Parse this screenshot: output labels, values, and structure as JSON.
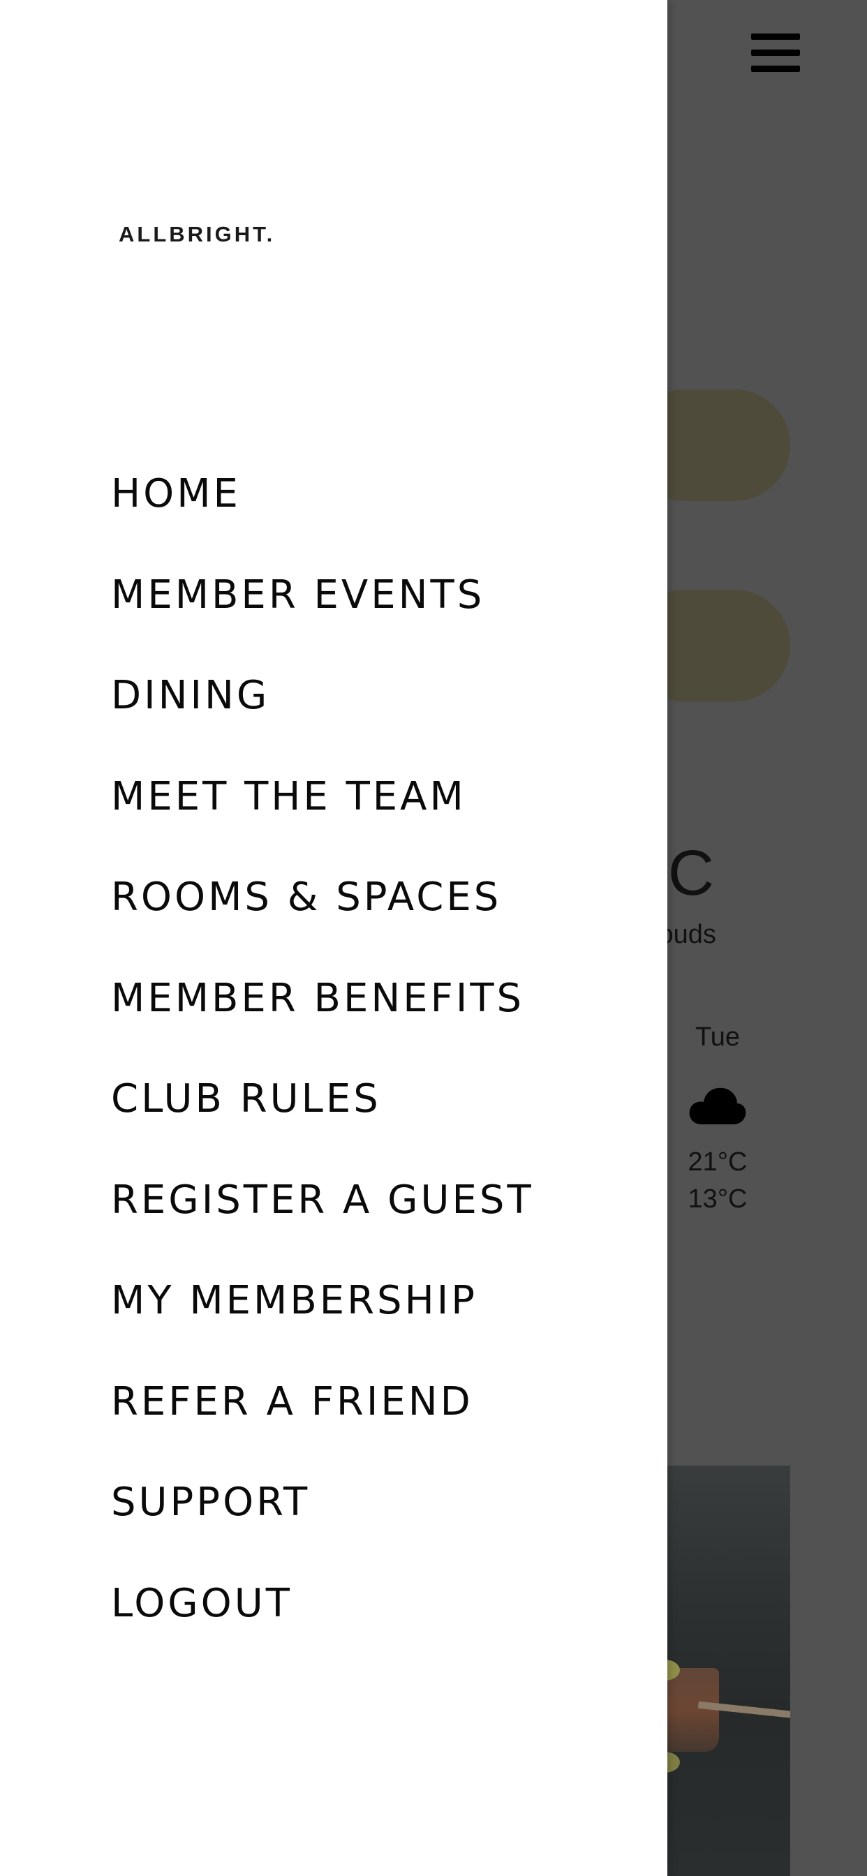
{
  "background": {
    "weather": {
      "current_temp_partial": "°C",
      "description_partial": "louds",
      "forecast": [
        {
          "day": "Tue",
          "icon": "cloud-icon",
          "high": "21°C",
          "low": "13°C"
        }
      ]
    }
  },
  "drawer": {
    "logo_text": "ALLBRIGHT.",
    "menu_items": [
      {
        "label": "HOME"
      },
      {
        "label": "MEMBER EVENTS"
      },
      {
        "label": "DINING"
      },
      {
        "label": "MEET THE TEAM"
      },
      {
        "label": "ROOMS & SPACES"
      },
      {
        "label": "MEMBER BENEFITS"
      },
      {
        "label": "CLUB RULES"
      },
      {
        "label": "REGISTER A GUEST"
      },
      {
        "label": "MY MEMBERSHIP"
      },
      {
        "label": "REFER A FRIEND"
      },
      {
        "label": "SUPPORT"
      },
      {
        "label": "LOGOUT"
      }
    ]
  },
  "colors": {
    "overlay": "#525252",
    "pill": "#4e4b3a",
    "drawer_bg": "#ffffff",
    "menu_text": "#0a0a0a"
  }
}
